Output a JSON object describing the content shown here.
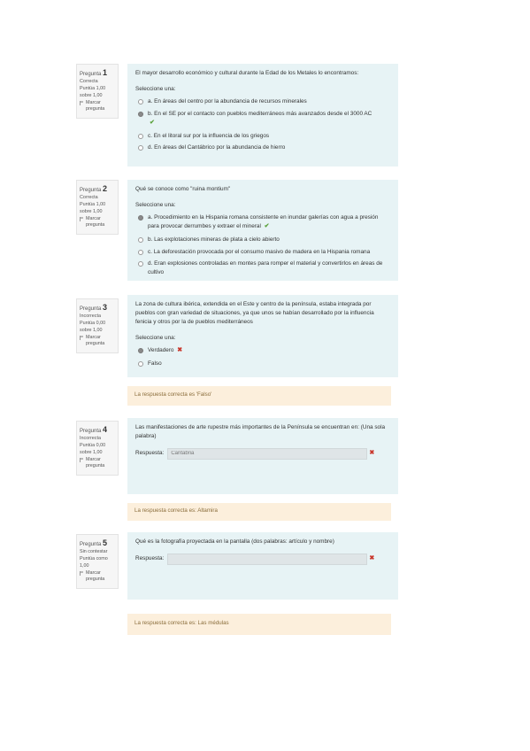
{
  "questions": [
    {
      "number_prefix": "Pregunta",
      "number": "1",
      "status": "Correcta",
      "score": "Puntúa 1,00 sobre 1,00",
      "flag_label": "Marcar pregunta",
      "text": "El mayor desarrollo económico y cultural durante la Edad de los Metales lo encontramos:",
      "prompt": "Seleccione una:",
      "options": [
        {
          "label": "a. En áreas del centro por la abundancia de recursos minerales"
        },
        {
          "label": "b. En el SE por el contacto con pueblos mediterráneos más avanzados desde el 3000 AC",
          "mark": "✔"
        },
        {
          "label": "c. En el litoral sur por la influencia de los griegos"
        },
        {
          "label": "d. En áreas del Cantábrico por la abundancia de hierro"
        }
      ]
    },
    {
      "number_prefix": "Pregunta",
      "number": "2",
      "status": "Correcta",
      "score": "Puntúa 1,00 sobre 1,00",
      "flag_label": "Marcar pregunta",
      "text": "Qué se conoce como \"ruina montium\"",
      "prompt": "Seleccione una:",
      "options": [
        {
          "label": "a. Procedimiento en la Hispania romana consistente en inundar galerías con agua a presión para provocar derrumbes y extraer el mineral",
          "mark": "✔"
        },
        {
          "label": "b. Las explotaciones mineras de plata a cielo abierto"
        },
        {
          "label": "c. La deforestación provocada por el consumo masivo de madera en la Hispania romana"
        },
        {
          "label": "d. Eran explosiones controladas en montes para romper el material y convertirlos en áreas de cultivo"
        }
      ]
    },
    {
      "number_prefix": "Pregunta",
      "number": "3",
      "status": "Incorrecta",
      "score": "Puntúa 0,00 sobre 1,00",
      "flag_label": "Marcar pregunta",
      "text": "La zona de cultura ibérica, extendida en el Este y centro de la península, estaba integrada por pueblos con gran variedad de situaciones, ya que unos se habían desarrollado por la influencia fenicia y otros por la de pueblos mediterráneos",
      "prompt": "Seleccione una:",
      "options": [
        {
          "label": "Verdadero",
          "mark": "✖"
        },
        {
          "label": "Falso"
        }
      ],
      "feedback": "La respuesta correcta es 'Falso'"
    },
    {
      "number_prefix": "Pregunta",
      "number": "4",
      "status": "Incorrecta",
      "score": "Puntúa 0,00 sobre 1,00",
      "flag_label": "Marcar pregunta",
      "text": "Las manifestaciones de arte rupestre más importantes de la Península se encuentran en: (Una sola palabra)",
      "answer_label": "Respuesta:",
      "answer_value": "Cantabria",
      "mark": "✖",
      "feedback": "La respuesta correcta es: Altamira"
    },
    {
      "number_prefix": "Pregunta",
      "number": "5",
      "status": "Sin contestar",
      "score": "Puntúa como 1,00",
      "flag_label": "Marcar pregunta",
      "text": "Qué es la fotografía proyectada en la pantalla (dos palabras: artículo y nombre)",
      "answer_label": "Respuesta:",
      "answer_value": "",
      "mark": "✖",
      "feedback": "La respuesta correcta es: Las médulas"
    }
  ],
  "colors": {
    "question_bg": "#e7f3f5",
    "feedback_bg": "#fcefdc",
    "correct": "#5aa13a",
    "incorrect": "#c9372c"
  }
}
